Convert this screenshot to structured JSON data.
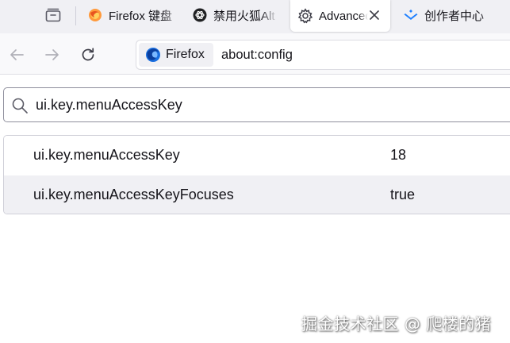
{
  "tabs": [
    {
      "title": "Firefox 键盘",
      "icon": "firefox-orange-icon"
    },
    {
      "title": "禁用火狐Alt",
      "icon": "openai-icon"
    },
    {
      "title": "Advanced",
      "icon": "gear-icon",
      "active": true
    },
    {
      "title": "创作者中心",
      "icon": "juejin-icon"
    }
  ],
  "navbar": {
    "identity_label": "Firefox",
    "url": "about:config"
  },
  "search": {
    "value": "ui.key.menuAccessKey"
  },
  "prefs": [
    {
      "name": "ui.key.menuAccessKey",
      "value": "18"
    },
    {
      "name": "ui.key.menuAccessKeyFocuses",
      "value": "true"
    }
  ],
  "watermark": "掘金技术社区 @ 爬楼的猪",
  "colors": {
    "tabstrip_bg": "#f0f0f4",
    "active_row_bg": "#f0f0f4",
    "text": "#15141a"
  }
}
